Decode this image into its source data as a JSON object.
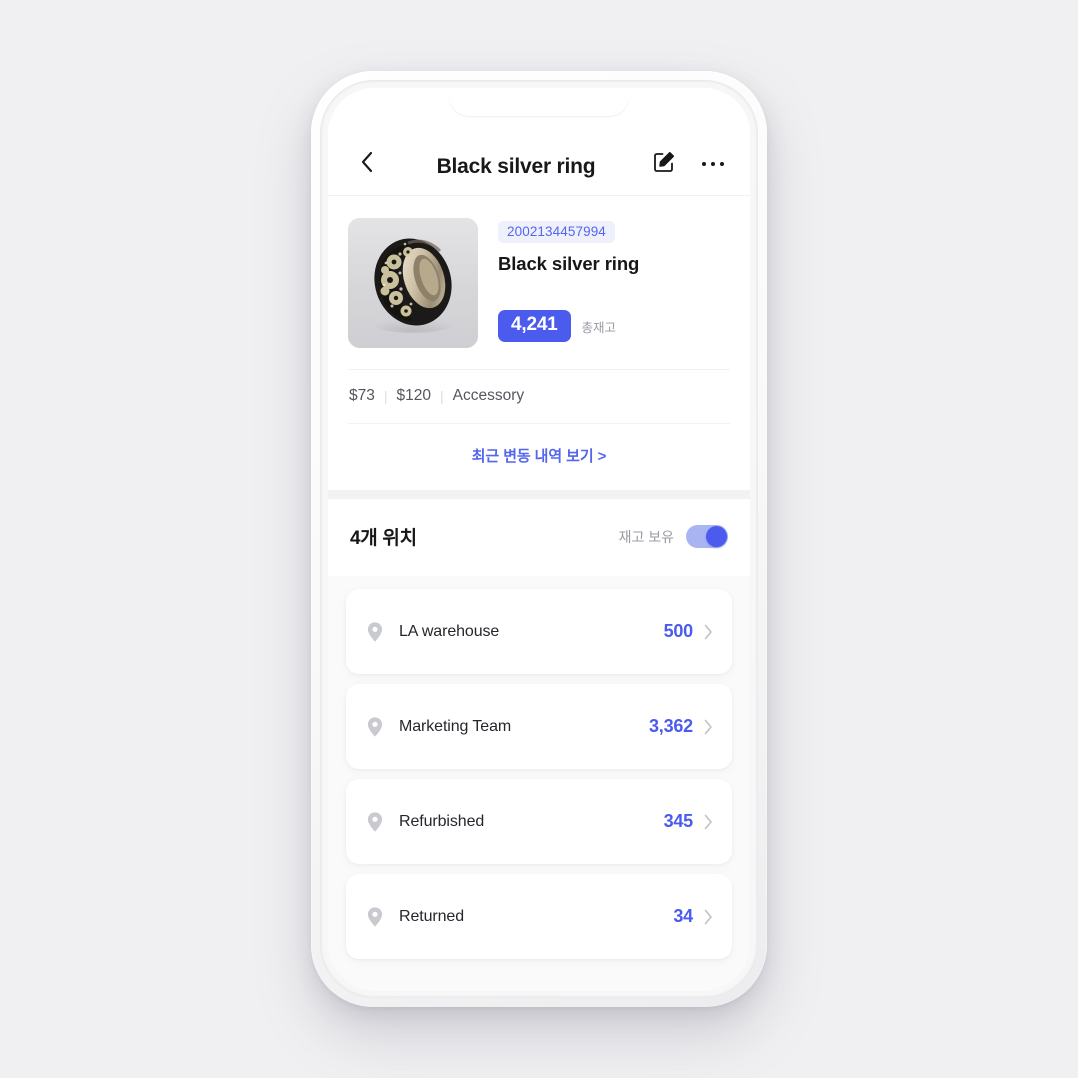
{
  "header": {
    "back_icon": "chevron-left-icon",
    "title": "Black silver ring",
    "edit_icon": "edit-pencil-icon",
    "more_icon": "more-horizontal-icon"
  },
  "product": {
    "image_alt": "black-silver-ring-photo",
    "sku": "2002134457994",
    "name": "Black silver ring",
    "total_stock": "4,241",
    "total_stock_label": "총재고",
    "cost_price": "$73",
    "retail_price": "$120",
    "category": "Accessory",
    "separator": "|",
    "history_link": "최근 변동 내역 보기 >"
  },
  "locations_section": {
    "title": "4개 위치",
    "toggle_label": "재고 보유",
    "toggle_on": true,
    "items": [
      {
        "icon": "map-pin-icon",
        "name": "LA warehouse",
        "qty": "500",
        "chevron": "chevron-right-icon"
      },
      {
        "icon": "map-pin-icon",
        "name": "Marketing Team",
        "qty": "3,362",
        "chevron": "chevron-right-icon"
      },
      {
        "icon": "map-pin-icon",
        "name": "Refurbished",
        "qty": "345",
        "chevron": "chevron-right-icon"
      },
      {
        "icon": "map-pin-icon",
        "name": "Returned",
        "qty": "34",
        "chevron": "chevron-right-icon"
      }
    ]
  },
  "colors": {
    "accent_blue": "#4a5bee",
    "link_blue": "#5566ee",
    "sku_pill_bg": "#eef1fc",
    "page_bg": "#f0f0f2",
    "card_bg": "#ffffff",
    "muted_text": "#9a9aa4"
  }
}
